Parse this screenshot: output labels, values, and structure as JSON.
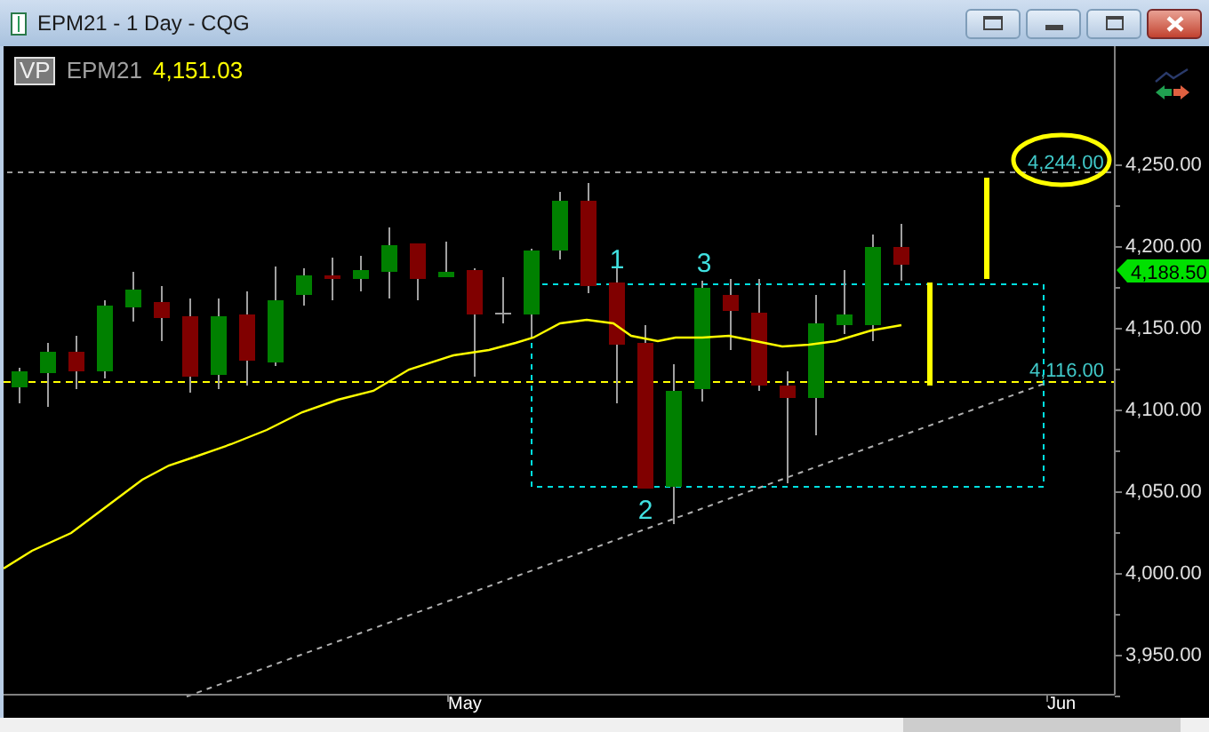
{
  "window": {
    "title": "EPM21 - 1 Day - CQG"
  },
  "header": {
    "badge": "VP",
    "symbol": "EPM21",
    "price": "4,151.03"
  },
  "chart": {
    "price_axis": [
      "4,250.00",
      "4,200.00",
      "4,150.00",
      "4,100.00",
      "4,050.00",
      "4,000.00",
      "3,950.00"
    ],
    "last_price": "4,188.50",
    "level_labels": [
      "4,244.00",
      "4,116.00"
    ],
    "wave_labels": [
      "1",
      "2",
      "3"
    ],
    "time_axis": [
      "May",
      "Jun"
    ]
  }
}
